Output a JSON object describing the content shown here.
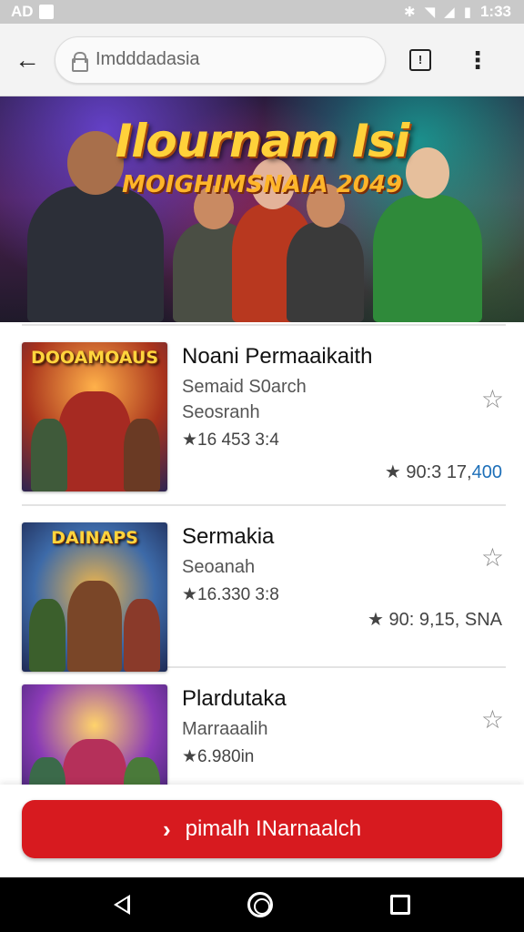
{
  "status_bar": {
    "left_text": "AD",
    "time": "1:33"
  },
  "app_bar": {
    "url": "Imdddadasia"
  },
  "banner": {
    "title": "Ilournam Isi",
    "subtitle": "MOIGHIMSNAIA 2049"
  },
  "items": [
    {
      "logo": "DOOAMOAUS",
      "title": "Noani Permaaikaith",
      "subtitle": "Semaid S0arch",
      "subtitle2": "Seosranh",
      "count": "★16 453 3:4",
      "rating_prefix": "★ 90:3 17,",
      "rating_accent": "400"
    },
    {
      "logo": "DAINAPS",
      "title": "Sermakia",
      "subtitle": "Seoanah",
      "subtitle2": "",
      "count": "★16.330 3:8",
      "rating_prefix": "★ 90: 9,15, SNA",
      "rating_accent": ""
    },
    {
      "logo": "",
      "title": "Plardutaka",
      "subtitle": "Marraaalih",
      "subtitle2": "",
      "count": "★6.980in",
      "rating_prefix": "",
      "rating_accent": ""
    }
  ],
  "action_button": {
    "label": "pimalh INarnaalch"
  },
  "colors": {
    "accent": "#d71a1f",
    "link": "#1d6fb8"
  },
  "icons": [
    "back-arrow-icon",
    "lock-icon",
    "tab-icon",
    "more-vert-icon",
    "star-outline-icon",
    "star-filled-icon",
    "chevron-right-icon",
    "nav-back-icon",
    "nav-home-icon",
    "nav-recent-icon"
  ]
}
